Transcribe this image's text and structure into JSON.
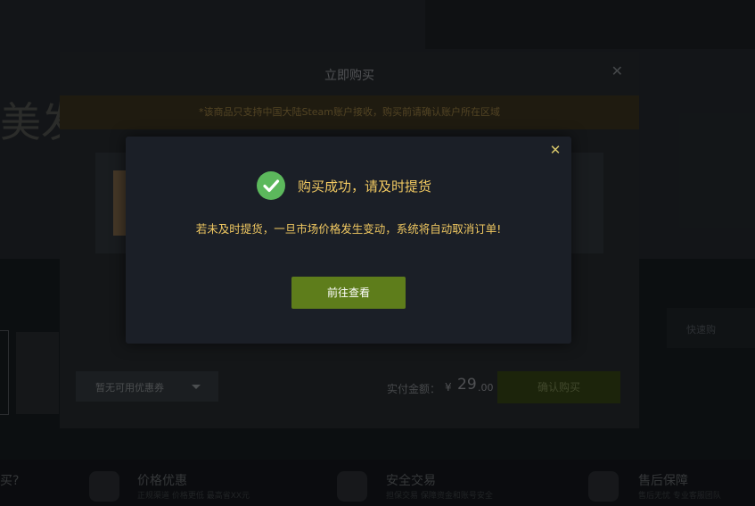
{
  "background": {
    "hero_text": "美发 你开",
    "side_button": "快速购",
    "footer": {
      "left_fragment": "买?",
      "items": [
        {
          "title": "价格优惠",
          "sub": "正规渠道 价格更低 最高省XX元",
          "icon": "tag-icon"
        },
        {
          "title": "安全交易",
          "sub": "担保交易 保障资金和账号安全",
          "icon": "shield-icon"
        },
        {
          "title": "售后保障",
          "sub": "售后无忧 专业客服团队",
          "icon": "heart-icon"
        }
      ]
    }
  },
  "purchase_panel": {
    "title": "立即购买",
    "notice": "*该商品只支持中国大陆Steam账户接收，购买前请确认账户所在区域",
    "coupon_placeholder": "暂无可用优惠券",
    "total_label": "实付金额：",
    "currency": "¥",
    "price_int": "29",
    "price_dec": ".00",
    "confirm_label": "确认购买"
  },
  "success_modal": {
    "title": "购买成功，请及时提货",
    "message": "若未及时提货，一旦市场价格发生变动，系统将自动取消订单!",
    "button_label": "前往查看",
    "colors": {
      "accent": "#f0c861",
      "button": "#5e7d1b",
      "check": "#5cb85c",
      "bg": "#1b1f27"
    }
  }
}
